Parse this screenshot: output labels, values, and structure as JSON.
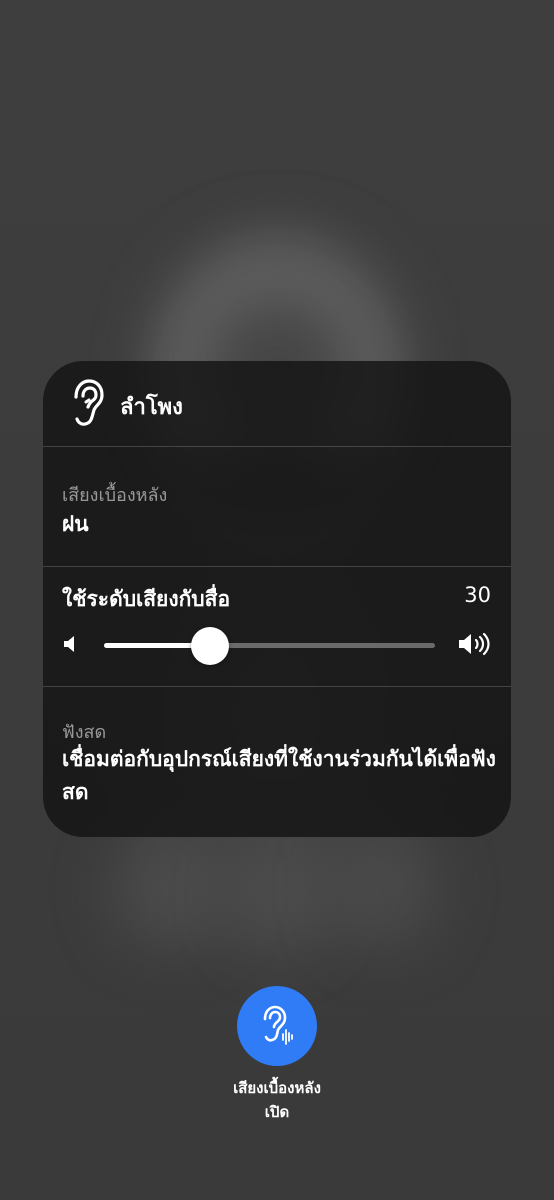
{
  "panel": {
    "header": {
      "title": "ลำโพง",
      "icon": "ear-icon"
    },
    "background_sound": {
      "label": "เสียงเบื้องหลัง",
      "value": "ฝน"
    },
    "media_volume": {
      "label": "ใช้ระดับเสียงกับสื่อ",
      "value": "30",
      "level_fraction": 0.32,
      "icon_low": "speaker-low-icon",
      "icon_high": "speaker-high-icon"
    },
    "live_listen": {
      "label": "ฟังสด",
      "description": "เชื่อมต่อกับอุปกรณ์เสียงที่ใช้งานร่วมกันได้เพื่อฟังสด"
    }
  },
  "toggle": {
    "label": "เสียงเบื้องหลัง",
    "status": "เปิด",
    "icon": "ear-sound-icon",
    "color": "#2f7cf6"
  }
}
